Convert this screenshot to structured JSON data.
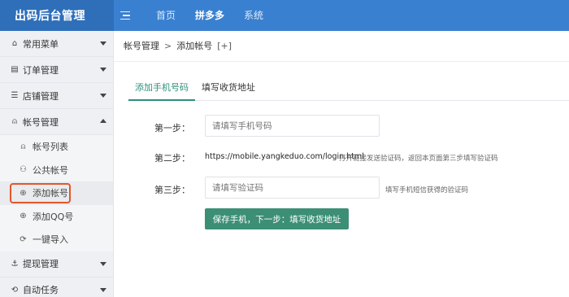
{
  "brand": "出码后台管理",
  "topnav": [
    "首页",
    "拼多多",
    "系统"
  ],
  "sidebar": {
    "common": "常用菜单",
    "orders": "订单管理",
    "shops": "店铺管理",
    "accounts": "帐号管理",
    "sub": [
      "帐号列表",
      "公共帐号",
      "添加帐号",
      "添加QQ号",
      "一键导入"
    ],
    "withdraw": "提现管理",
    "auto": "自动任务"
  },
  "breadcrumb": {
    "parent": "帐号管理",
    "sep": ">",
    "current": "添加帐号",
    "plus": "[+]"
  },
  "tabs": [
    "添加手机号码",
    "填写收货地址"
  ],
  "step1": {
    "label": "第一步：",
    "placeholder": "请填写手机号码"
  },
  "step2": {
    "label": "第二步：",
    "url": "https://mobile.yangkeduo.com/login.html",
    "hint": "打开链接发送验证码，返回本页面第三步填写验证码"
  },
  "step3": {
    "label": "第三步：",
    "placeholder": "请填写验证码",
    "hint": "填写手机短信获得的验证码"
  },
  "submit": "保存手机，下一步：填写收货地址"
}
